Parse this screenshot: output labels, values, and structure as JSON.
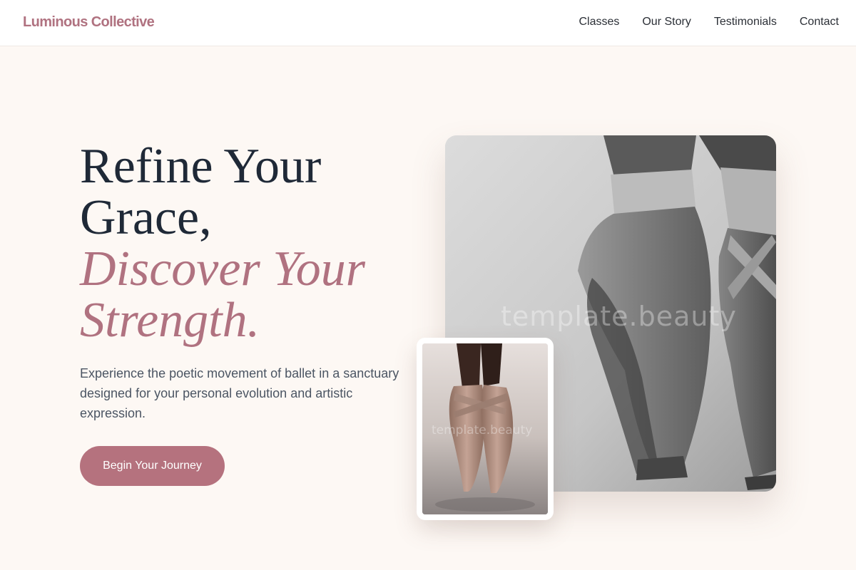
{
  "header": {
    "brand": "Luminous Collective",
    "nav": [
      "Classes",
      "Our Story",
      "Testimonials",
      "Contact"
    ]
  },
  "hero": {
    "title_line1": "Refine Your",
    "title_line2": "Grace,",
    "accent_line1": "Discover Your",
    "accent_line2": "Strength.",
    "subtitle": "Experience the poetic movement of ballet in a sanctuary designed for your personal evolution and artistic expression.",
    "cta_label": "Begin Your Journey"
  },
  "images": {
    "main_watermark": "template.beauty",
    "inset_watermark": "template.beauty"
  },
  "colors": {
    "accent": "#b07280",
    "button": "#b5727e",
    "background": "#fdf8f4",
    "heading": "#1f2937"
  }
}
